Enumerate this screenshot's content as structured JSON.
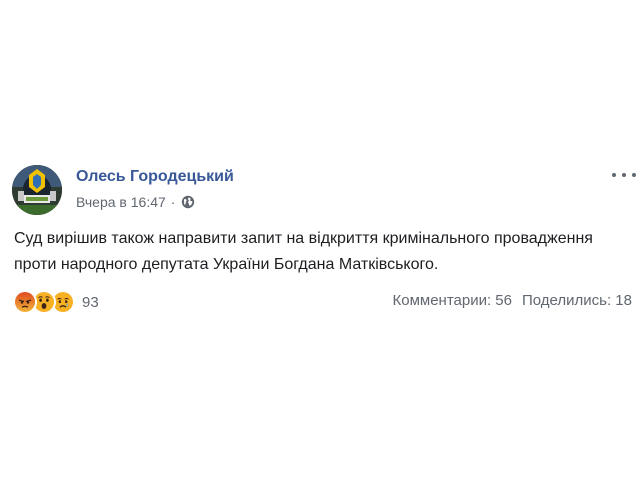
{
  "post": {
    "author": "Олесь Городецький",
    "timestamp": "Вчера в 16:47",
    "separator": "·",
    "privacy_icon": "globe-icon",
    "text": "Суд вирішив також направити запит на відкриття кримінального провадження проти народного депутата України Богдана Матківського."
  },
  "reactions": {
    "icons": [
      "angry-reaction-icon",
      "wow-reaction-icon",
      "sad-reaction-icon"
    ],
    "count": "93"
  },
  "stats": {
    "comments_label": "Комментарии: 56",
    "shares_label": "Поделились: 18"
  },
  "colors": {
    "author": "#385898",
    "meta": "#616770",
    "text": "#1c1e21",
    "reaction_angry": "#e9710f",
    "reaction_wow": "#f7b125"
  }
}
